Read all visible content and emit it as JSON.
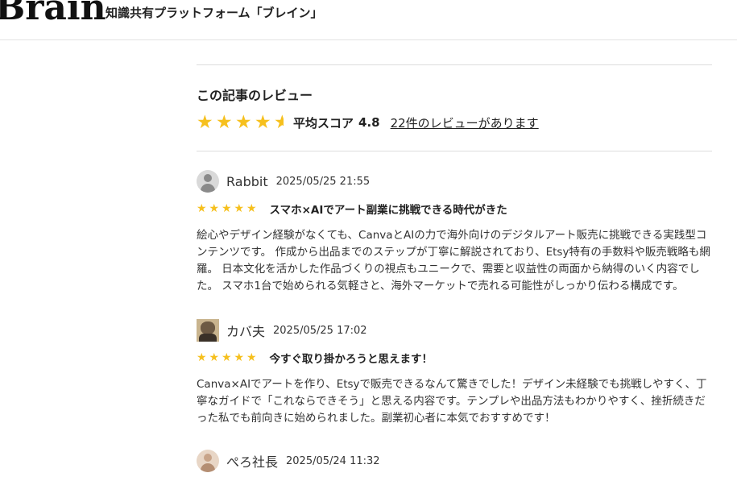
{
  "header": {
    "logo_text": "Brain",
    "tagline": "知識共有プラットフォーム「ブレイン」"
  },
  "review_summary": {
    "heading": "この記事のレビュー",
    "average_label": "平均スコア",
    "average_score": "4.8",
    "rating_value": 4.8,
    "review_count_link": "22件のレビューがあります",
    "star_color": "#f6c01e"
  },
  "reviews": [
    {
      "avatar": "user-default-icon",
      "name": "Rabbit",
      "date": "2025/05/25 21:55",
      "rating": 5,
      "title": "スマホ×AIでアート副業に挑戦できる時代がきた",
      "body": "絵心やデザイン経験がなくても、CanvaとAIの力で海外向けのデジタルアート販売に挑戦できる実践型コンテンツです。 作成から出品までのステップが丁寧に解説されており、Etsy特有の手数料や販売戦略も網羅。 日本文化を活かした作品づくりの視点もユニークで、需要と収益性の両面から納得のいく内容でした。 スマホ1台で始められる気軽さと、海外マーケットで売れる可能性がしっかり伝わる構成です。"
    },
    {
      "avatar": "hippo-avatar",
      "name": "カバ夫",
      "date": "2025/05/25 17:02",
      "rating": 5,
      "title": "今すぐ取り掛かろうと思えます！",
      "body": "Canva×AIでアートを作り、Etsyで販売できるなんて驚きでした！デザイン未経験でも挑戦しやすく、丁寧なガイドで「これならできそう」と思える内容です。テンプレや出品方法もわかりやすく、挫折続きだった私でも前向きに始められました。副業初心者に本気でおすすめです！"
    },
    {
      "avatar": "person-avatar",
      "name": "ぺろ社長",
      "date": "2025/05/24 11:32"
    }
  ]
}
